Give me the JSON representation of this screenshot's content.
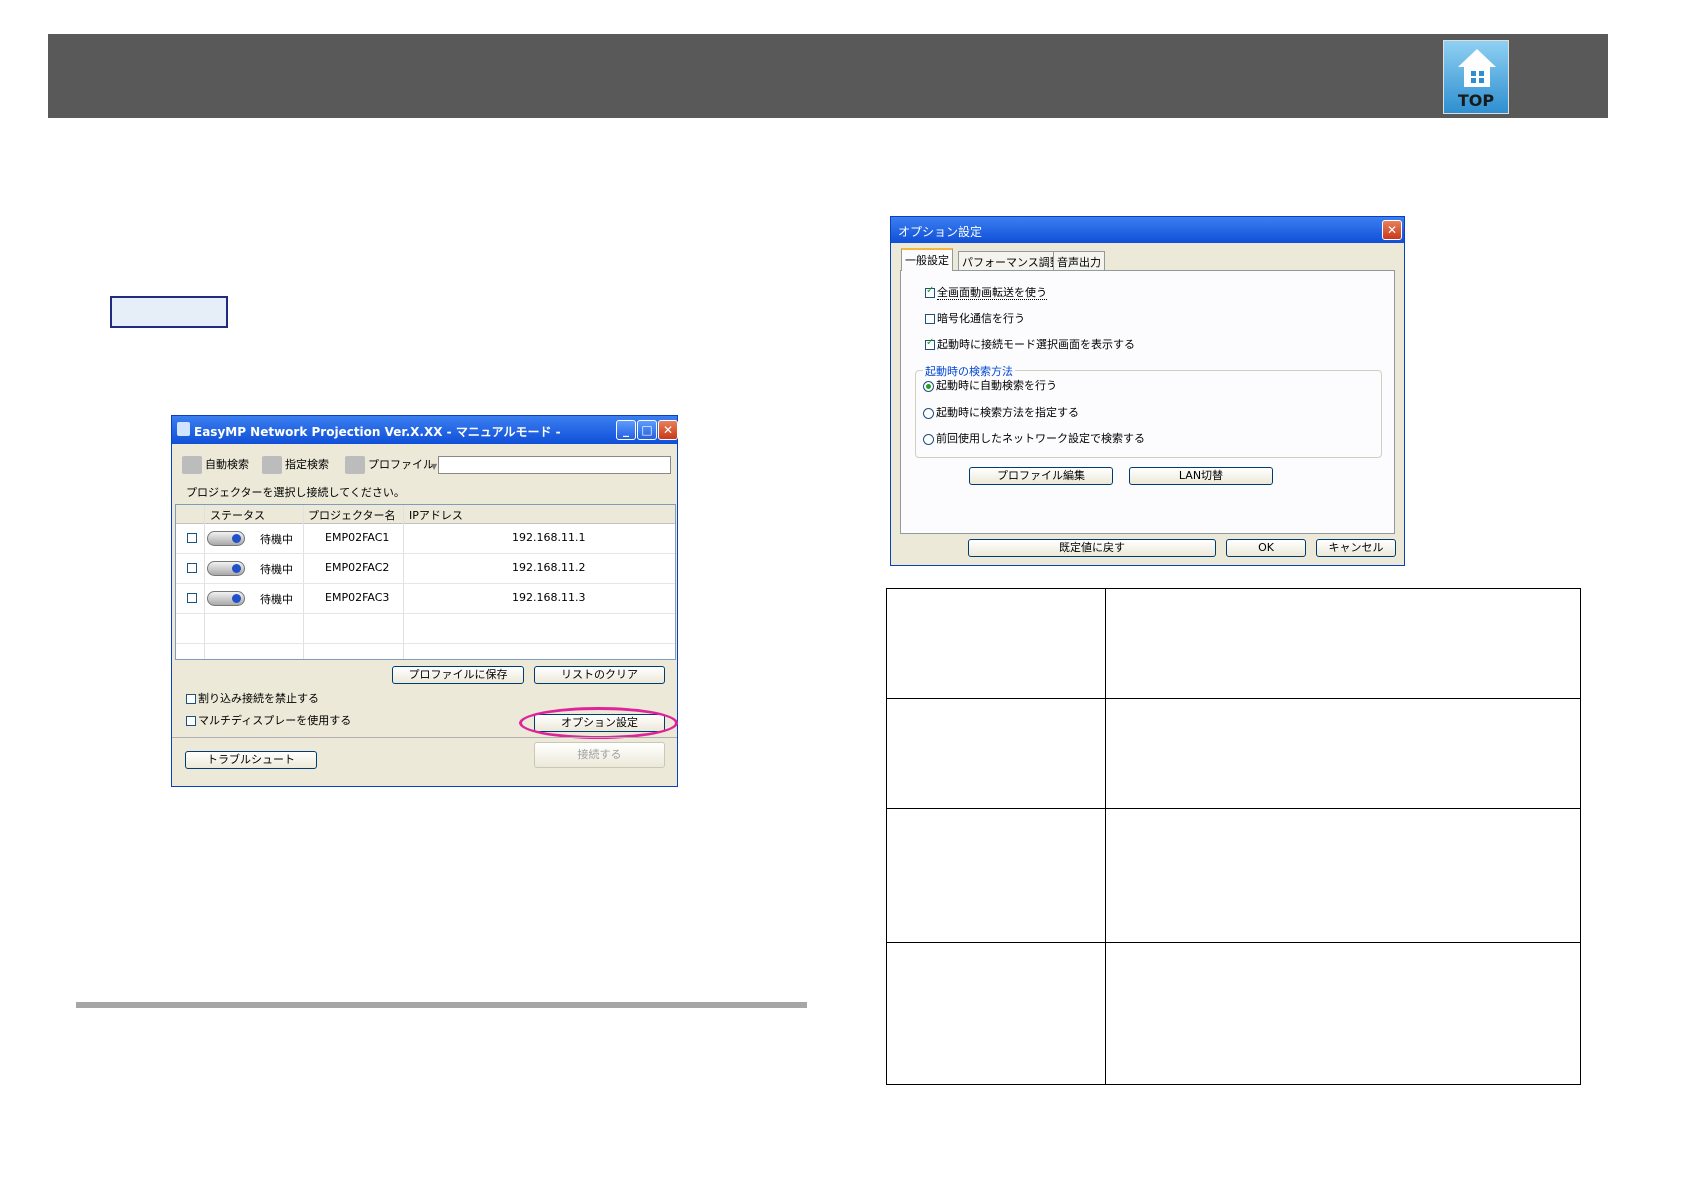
{
  "header": {
    "top_icon_label": "TOP"
  },
  "main_window": {
    "title": "EasyMP Network Projection Ver.X.XX - マニュアルモード -",
    "toolbar": {
      "auto_search": "自動検索",
      "specified_search": "指定検索",
      "profile": "プロファイル"
    },
    "instruction": "プロジェクターを選択し接続してください。",
    "columns": [
      "ステータス",
      "プロジェクター名",
      "IPアドレス"
    ],
    "rows": [
      {
        "status": "待機中",
        "name": "EMP02FAC1",
        "ip": "192.168.11.1"
      },
      {
        "status": "待機中",
        "name": "EMP02FAC2",
        "ip": "192.168.11.2"
      },
      {
        "status": "待機中",
        "name": "EMP02FAC3",
        "ip": "192.168.11.3"
      }
    ],
    "save_profile_button": "プロファイルに保存",
    "clear_list_button": "リストのクリア",
    "interrupt_option": "割り込み接続を禁止する",
    "multi_display_option": "マルチディスプレーを使用する",
    "options_button": "オプション設定",
    "troubleshoot_button": "トラブルシュート",
    "connect_button": "接続する"
  },
  "option_dialog": {
    "title": "オプション設定",
    "tabs": [
      "一般設定",
      "パフォーマンス調整",
      "音声出力"
    ],
    "check_fullscreen_video": "全画面動画転送を使う",
    "check_encryption": "暗号化通信を行う",
    "check_mode_select": "起動時に接続モード選択画面を表示する",
    "group_label": "起動時の検索方法",
    "radio_auto_search": "起動時に自動検索を行う",
    "radio_specify_method": "起動時に検索方法を指定する",
    "radio_last_network": "前回使用したネットワーク設定で検索する",
    "edit_profile_button": "プロファイル編集",
    "lan_switch_button": "LAN切替",
    "restore_default_button": "既定値に戻す",
    "ok_button": "OK",
    "cancel_button": "キャンセル"
  }
}
